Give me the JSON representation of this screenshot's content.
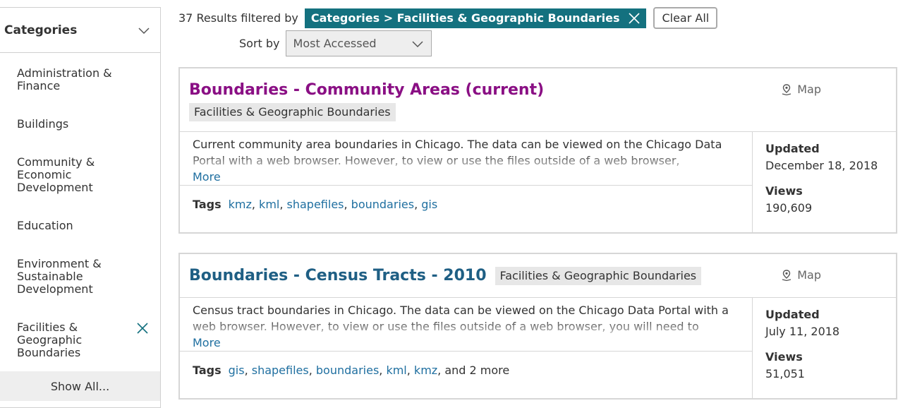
{
  "sidebar": {
    "title": "Categories",
    "items": [
      {
        "label": "Administration & Finance"
      },
      {
        "label": "Buildings"
      },
      {
        "label": "Community & Economic Development"
      },
      {
        "label": "Education"
      },
      {
        "label": "Environment & Sustainable Development"
      },
      {
        "label": "Facilities & Geographic Boundaries",
        "selected": true
      }
    ],
    "show_all": "Show All..."
  },
  "filter": {
    "results": "37 Results filtered by",
    "chip": "Categories > Facilities & Geographic Boundaries",
    "clear_all": "Clear All"
  },
  "sort": {
    "label": "Sort by",
    "selected": "Most Accessed"
  },
  "results": [
    {
      "title": "Boundaries - Community Areas (current)",
      "category": "Facilities & Geographic Boundaries",
      "type": "Map",
      "description": "Current community area boundaries in Chicago. The data can be viewed on the Chicago Data Portal with a web browser. However, to view or use the files outside of a web browser,",
      "more": "More",
      "tags_label": "Tags",
      "tags": [
        "kmz",
        "kml",
        "shapefiles",
        "boundaries",
        "gis"
      ],
      "tags_extra": "",
      "updated_label": "Updated",
      "updated": "December 18, 2018",
      "views_label": "Views",
      "views": "190,609"
    },
    {
      "title": "Boundaries - Census Tracts - 2010",
      "category": "Facilities & Geographic Boundaries",
      "type": "Map",
      "description": "Census tract boundaries in Chicago. The data can be viewed on the Chicago Data Portal with a web browser. However, to view or use the files outside of a web browser, you will need to",
      "more": "More",
      "tags_label": "Tags",
      "tags": [
        "gis",
        "shapefiles",
        "boundaries",
        "kml",
        "kmz"
      ],
      "tags_extra": ", and 2 more",
      "updated_label": "Updated",
      "updated": "July 11, 2018",
      "views_label": "Views",
      "views": "51,051"
    }
  ],
  "colors": {
    "accent": "#14717f",
    "link": "#1f6fa0",
    "visited_title": "#8a0f84",
    "title": "#1f5f84"
  }
}
